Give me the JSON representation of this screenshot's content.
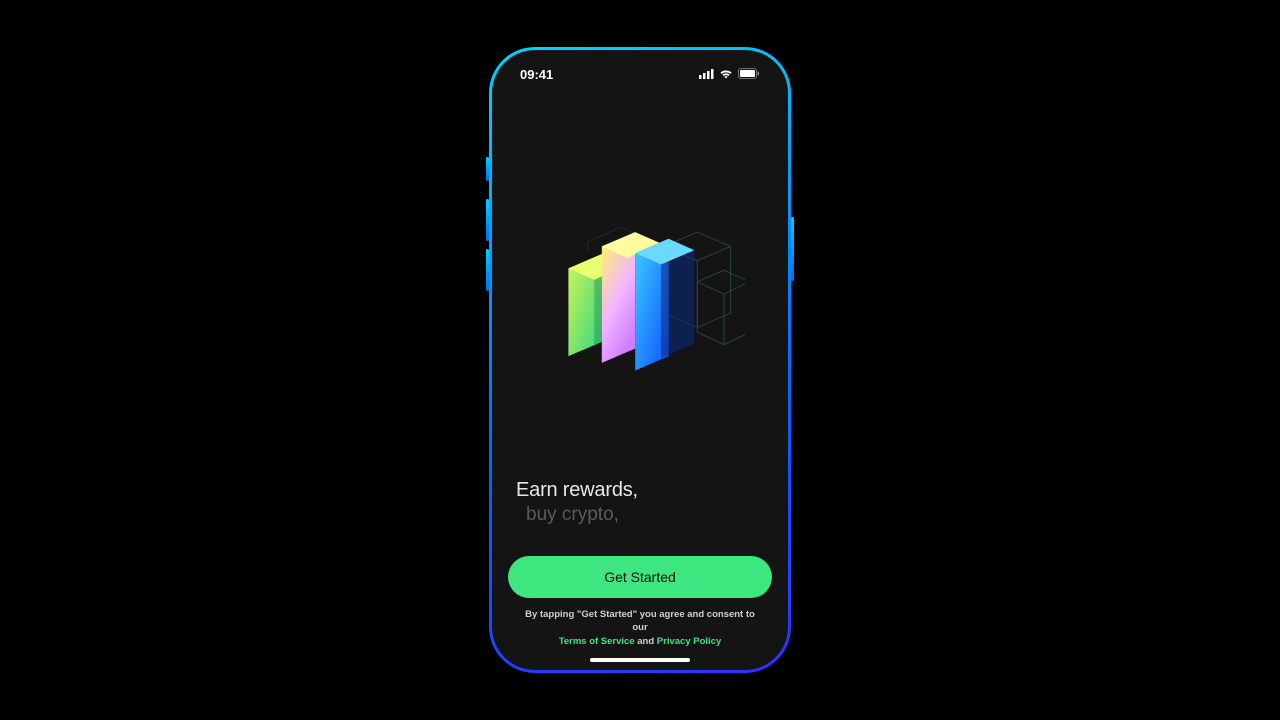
{
  "status": {
    "time": "09:41"
  },
  "tagline": {
    "line1": "Earn rewards,",
    "line2": "buy crypto,"
  },
  "cta": {
    "label": "Get Started"
  },
  "legal": {
    "prefix": "By tapping \"Get Started\" you agree and consent to our",
    "tos": "Terms of Service",
    "and": " and ",
    "privacy": "Privacy Policy"
  }
}
